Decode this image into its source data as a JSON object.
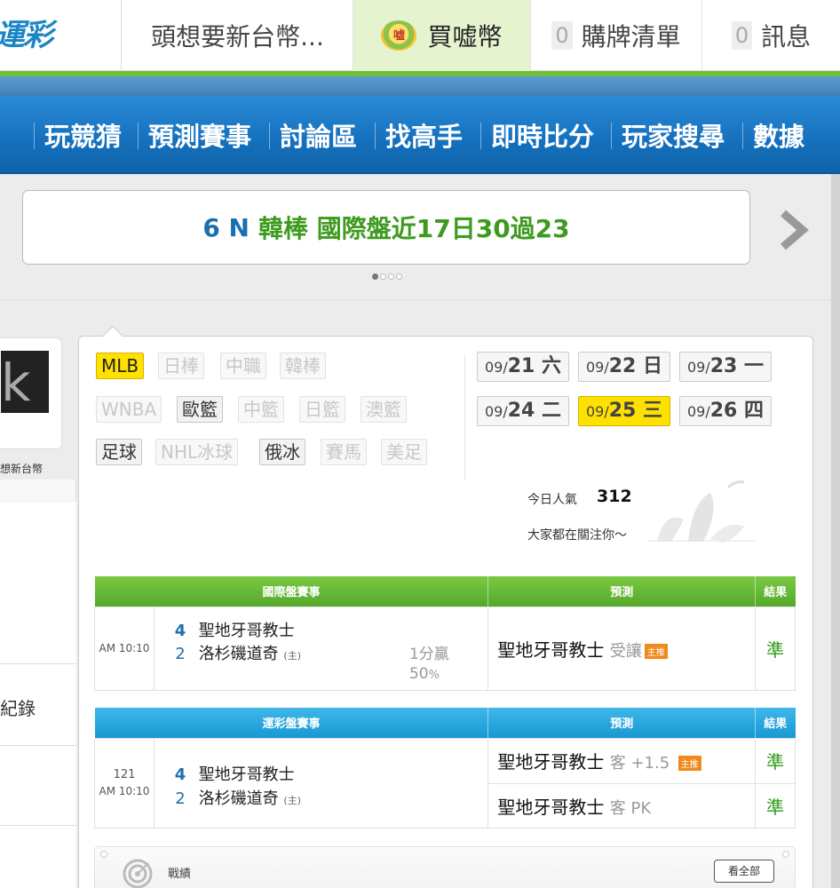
{
  "topbar": {
    "logo": "運彩",
    "user": "頭想要新台幣...",
    "buy_icon_char": "嘘",
    "buy": "買嘘幣",
    "cart_count": "0",
    "cart": "購牌清單",
    "msg_count": "0",
    "msg": "訊息"
  },
  "nav": {
    "items": [
      "玩競猜",
      "預測賽事",
      "討論區",
      "找高手",
      "即時比分",
      "玩家搜尋",
      "數據"
    ]
  },
  "banner": {
    "text_a": "6 N",
    "text_b": "韓棒 國際盤近17日30過23"
  },
  "sports": {
    "chips": [
      "MLB",
      "日棒",
      "中職",
      "韓棒",
      "WNBA",
      "歐籃",
      "中籃",
      "日籃",
      "澳籃",
      "足球",
      "NHL冰球",
      "俄冰",
      "賽馬",
      "美足"
    ]
  },
  "dates": [
    {
      "md": "09/",
      "day": "21 六"
    },
    {
      "md": "09/",
      "day": "22 日"
    },
    {
      "md": "09/",
      "day": "23 一"
    },
    {
      "md": "09/",
      "day": "24 二"
    },
    {
      "md": "09/",
      "day": "25 三"
    },
    {
      "md": "09/",
      "day": "26 四"
    }
  ],
  "popularity": {
    "label": "今日人氣",
    "value": "312",
    "sub": "大家都在關注你～"
  },
  "sidebar": {
    "name": "想新台幣",
    "record": "紀錄"
  },
  "intl_table": {
    "headers": [
      "國際盤賽事",
      "預測",
      "結果"
    ],
    "time": "AM 10:10",
    "team1_score": "4",
    "team1": "聖地牙哥教士",
    "team2_score": "2",
    "team2": "洛杉磯道奇",
    "host": "(主)",
    "odds_a": "1分贏",
    "odds_b": "50",
    "odds_pct": "%",
    "pred_team": "聖地牙哥教士",
    "pred_note": "受讓",
    "tag": "主推",
    "result": "準"
  },
  "lottery_table": {
    "headers": [
      "運彩盤賽事",
      "預測",
      "結果"
    ],
    "code": "121",
    "time": "AM 10:10",
    "team1_score": "4",
    "team1": "聖地牙哥教士",
    "team2_score": "2",
    "team2": "洛杉磯道奇",
    "host": "(主)",
    "pred1_team": "聖地牙哥教士",
    "pred1_note": "客 +1.5",
    "pred1_tag": "主推",
    "result1": "準",
    "pred2_team": "聖地牙哥教士",
    "pred2_note": "客 PK",
    "result2": "準"
  },
  "record_bar": {
    "title": "戰績",
    "view_all": "看全部"
  }
}
